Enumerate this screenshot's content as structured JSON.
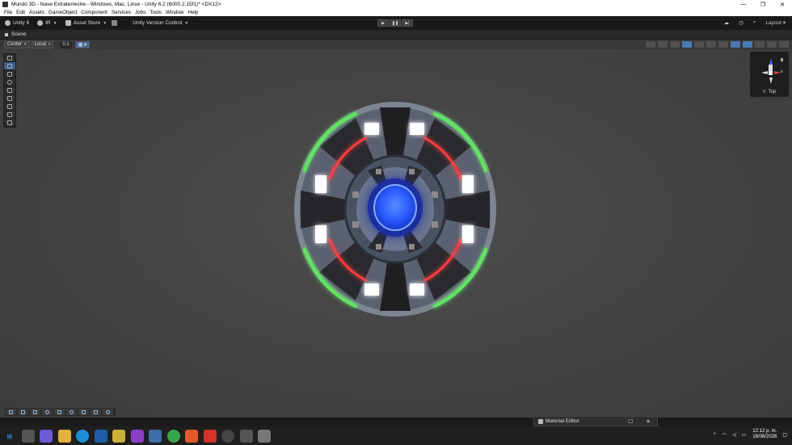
{
  "window": {
    "title": "Mundo 3D - Nave Extraterrestre - Windows, Mac, Linux - Unity 6.2 (6000.2.15f1)* <DX12>",
    "controls": [
      "—",
      "❐",
      "✕"
    ]
  },
  "menu": [
    "File",
    "Edit",
    "Assets",
    "GameObject",
    "Component",
    "Services",
    "Jobs",
    "Tools",
    "Window",
    "Help"
  ],
  "toolbar": {
    "unity_label": "Unity 6",
    "account_label": "IR",
    "asset_store_label": "Asset Store",
    "version_control_label": "Unity Version Control",
    "layout_label": "Layout",
    "play_icons": [
      "▶",
      "❚❚",
      "▶|"
    ]
  },
  "scene_tab": {
    "label": "Scene"
  },
  "scene_toolbar": {
    "pivot_label": "Center",
    "space_label": "Local",
    "snap_value": "0.1"
  },
  "orientation_gizmo": {
    "view_label": "<: Top",
    "x_axis": "x"
  },
  "tools": [
    "view-tool",
    "hand-tool",
    "move-tool",
    "rotate-tool",
    "scale-tool",
    "rect-tool",
    "transform-tool",
    "custom-tool",
    "extra-tool"
  ],
  "material_editor": {
    "title": "Material Editor"
  },
  "taskbar": {
    "time": "12:12 p. m.",
    "date": "16/06/2026"
  },
  "colors": {
    "title_bg": "#ffffff",
    "editor_bg": "#191919",
    "viewport_bg": "#464646",
    "core_blue": "#2f6bff",
    "ring_green": "#5fe65f",
    "ring_red": "#ff3c3c",
    "selected_tool": "#3d5f8d"
  }
}
